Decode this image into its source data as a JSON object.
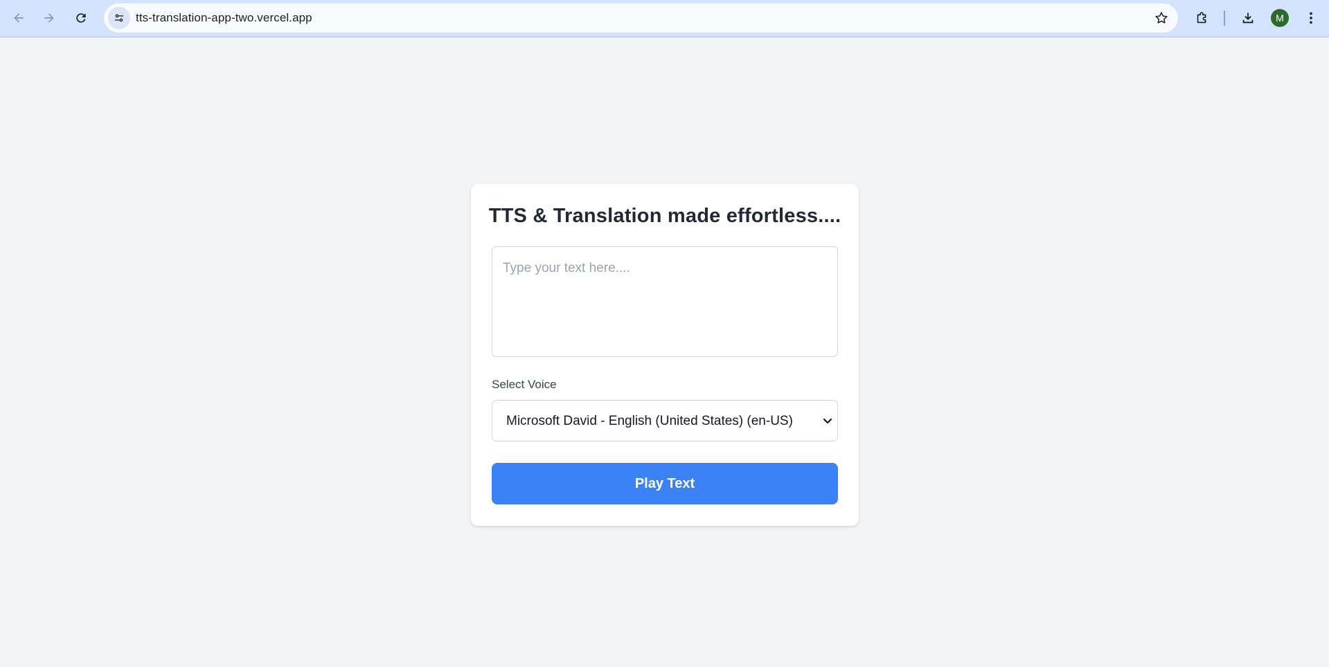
{
  "browser": {
    "url": "tts-translation-app-two.vercel.app",
    "profile_initial": "M",
    "icons": [
      "back-icon",
      "forward-icon",
      "reload-icon",
      "site-info-icon",
      "bookmark-star-icon",
      "extensions-icon",
      "download-icon",
      "menu-icon"
    ]
  },
  "app": {
    "title": "TTS & Translation made effortless....",
    "text_input": {
      "placeholder": "Type your text here....",
      "value": ""
    },
    "voice_label": "Select Voice",
    "voice_select": {
      "selected": "Microsoft David - English (United States) (en-US)"
    },
    "play_button": "Play Text"
  },
  "colors": {
    "page_bg": "#f3f4f6",
    "card_bg": "#ffffff",
    "primary": "#3b82f6",
    "chrome_bg": "#d3e3fd",
    "avatar_bg": "#2e6a2a"
  }
}
